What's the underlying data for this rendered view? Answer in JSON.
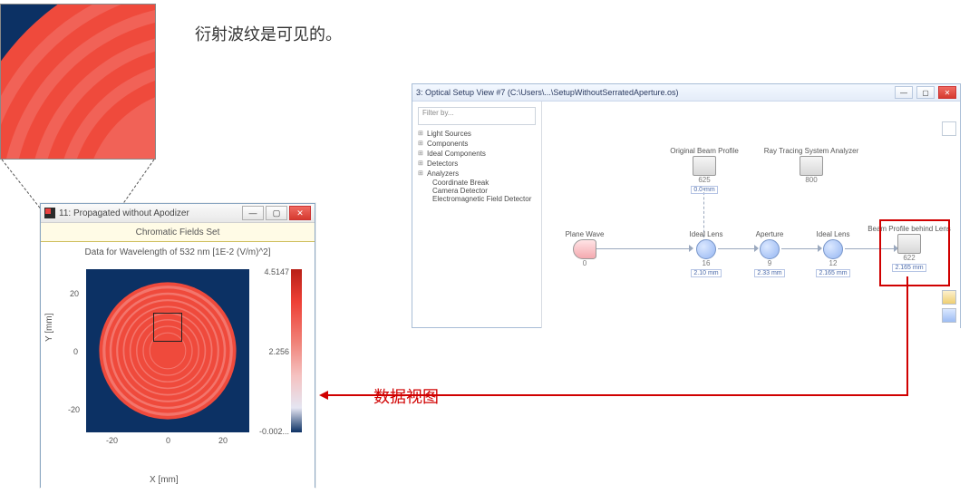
{
  "annotations": {
    "ripple_note": "衍射波纹是可见的。",
    "data_view": "数据视图"
  },
  "fields_window": {
    "title": "11: Propagated without Apodizer",
    "tab": "Chromatic Fields Set",
    "subtitle": "Data for Wavelength of 532 nm  [1E-2 (V/m)^2]",
    "x_axis": "X [mm]",
    "y_axis": "Y [mm]",
    "x_ticks": [
      "-20",
      "0",
      "20"
    ],
    "y_ticks": [
      "20",
      "0",
      "-20"
    ],
    "cb_ticks": {
      "max": "4.5147",
      "mid": "2.256",
      "min": "-0.002..."
    }
  },
  "setup_window": {
    "title": "3: Optical Setup View #7 (C:\\Users\\...\\SetupWithoutSerratedAperture.os)",
    "filter_label": "Filter by...",
    "tree": {
      "items": [
        "Light Sources",
        "Components",
        "Ideal Components",
        "Detectors",
        "Analyzers"
      ],
      "sub": [
        "Coordinate Break",
        "Camera Detector",
        "Electromagnetic Field Detector"
      ]
    },
    "nodes": {
      "plane_wave": {
        "label": "Plane Wave",
        "id": "0"
      },
      "orig_profile": {
        "label": "Original Beam Profile",
        "id": "625",
        "dist": "0.0 mm"
      },
      "rta": {
        "label": "Ray Tracing System Analyzer",
        "id": "800"
      },
      "lens1": {
        "label": "Ideal Lens",
        "id": "16",
        "dist": "2.10 mm"
      },
      "aperture": {
        "label": "Aperture",
        "id": "9",
        "dist": "2.33 mm"
      },
      "lens2": {
        "label": "Ideal Lens",
        "id": "12",
        "dist": "2.165 mm"
      },
      "profile2": {
        "label": "Beam Profile behind Lens",
        "id": "622",
        "dist": "2.165 mm"
      }
    }
  },
  "chart_data": {
    "type": "heatmap",
    "title": "Chromatic Fields Set",
    "subtitle": "Data for Wavelength of 532 nm  [1E-2 (V/m)^2]",
    "xlabel": "X [mm]",
    "ylabel": "Y [mm]",
    "xlim": [
      -30,
      30
    ],
    "ylim": [
      -30,
      30
    ],
    "color_scale": {
      "min": -0.002,
      "mid": 2.256,
      "max": 4.5147
    },
    "description": "Circular beam profile (~25 mm radius) with near-constant intensity ≈4.5 inside, ≈0 outside; concentric diffraction ripples visible on disk interior.",
    "note": "Diffraction ripples are visible (衍射波纹是可见的)."
  }
}
